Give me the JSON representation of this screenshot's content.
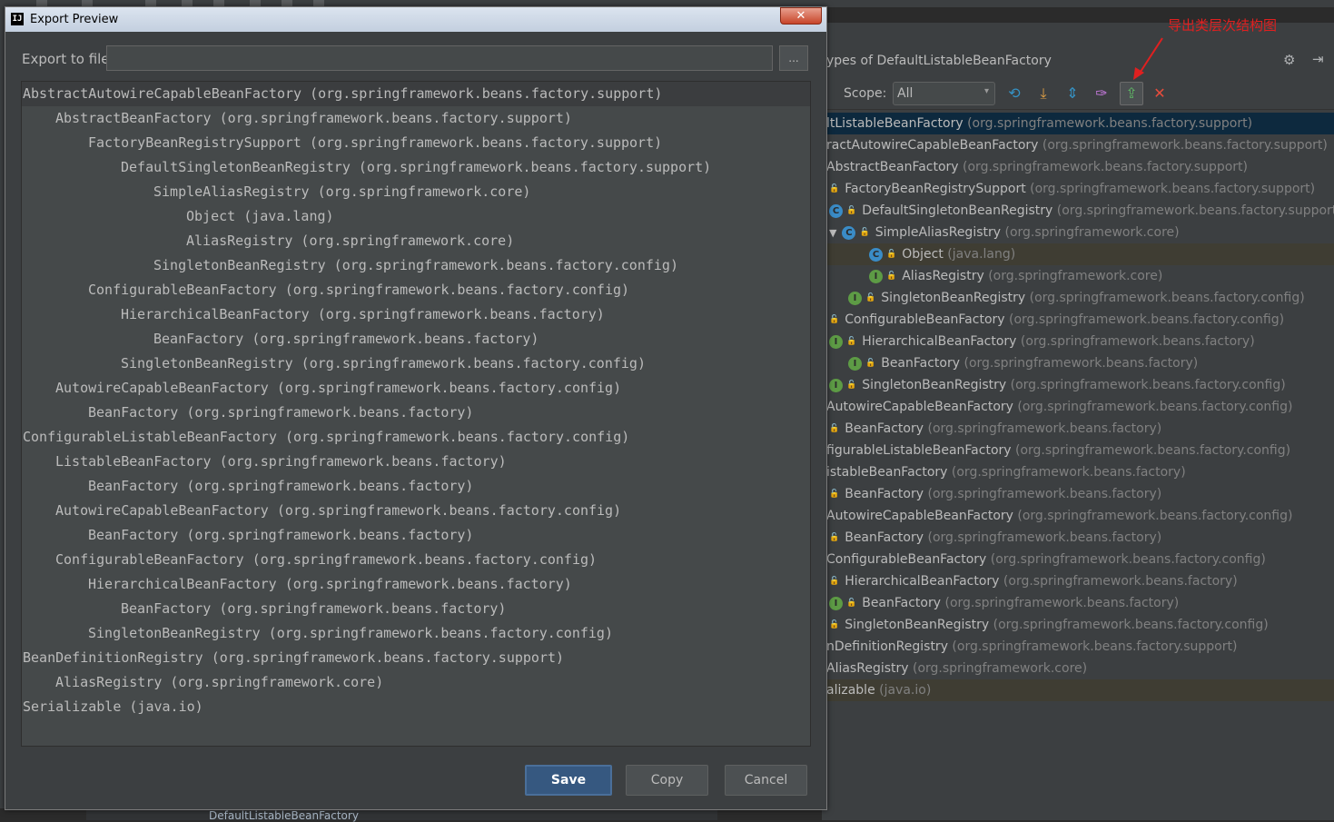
{
  "dialog": {
    "title": "Export Preview",
    "app_icon": "IJ",
    "close_glyph": "✕",
    "export_label": "Export to file:",
    "export_value": "",
    "browse_label": "...",
    "save_label": "Save",
    "copy_label": "Copy",
    "cancel_label": "Cancel",
    "lines": [
      {
        "depth": 0,
        "text": "AbstractAutowireCapableBeanFactory (org.springframework.beans.factory.support)"
      },
      {
        "depth": 1,
        "text": "AbstractBeanFactory (org.springframework.beans.factory.support)"
      },
      {
        "depth": 2,
        "text": "FactoryBeanRegistrySupport (org.springframework.beans.factory.support)"
      },
      {
        "depth": 3,
        "text": "DefaultSingletonBeanRegistry (org.springframework.beans.factory.support)"
      },
      {
        "depth": 4,
        "text": "SimpleAliasRegistry (org.springframework.core)"
      },
      {
        "depth": 5,
        "text": "Object (java.lang)"
      },
      {
        "depth": 5,
        "text": "AliasRegistry (org.springframework.core)"
      },
      {
        "depth": 4,
        "text": "SingletonBeanRegistry (org.springframework.beans.factory.config)"
      },
      {
        "depth": 2,
        "text": "ConfigurableBeanFactory (org.springframework.beans.factory.config)"
      },
      {
        "depth": 3,
        "text": "HierarchicalBeanFactory (org.springframework.beans.factory)"
      },
      {
        "depth": 4,
        "text": "BeanFactory (org.springframework.beans.factory)"
      },
      {
        "depth": 3,
        "text": "SingletonBeanRegistry (org.springframework.beans.factory.config)"
      },
      {
        "depth": 1,
        "text": "AutowireCapableBeanFactory (org.springframework.beans.factory.config)"
      },
      {
        "depth": 2,
        "text": "BeanFactory (org.springframework.beans.factory)"
      },
      {
        "depth": 0,
        "text": "ConfigurableListableBeanFactory (org.springframework.beans.factory.config)"
      },
      {
        "depth": 1,
        "text": "ListableBeanFactory (org.springframework.beans.factory)"
      },
      {
        "depth": 2,
        "text": "BeanFactory (org.springframework.beans.factory)"
      },
      {
        "depth": 1,
        "text": "AutowireCapableBeanFactory (org.springframework.beans.factory.config)"
      },
      {
        "depth": 2,
        "text": "BeanFactory (org.springframework.beans.factory)"
      },
      {
        "depth": 1,
        "text": "ConfigurableBeanFactory (org.springframework.beans.factory.config)"
      },
      {
        "depth": 2,
        "text": "HierarchicalBeanFactory (org.springframework.beans.factory)"
      },
      {
        "depth": 3,
        "text": "BeanFactory (org.springframework.beans.factory)"
      },
      {
        "depth": 2,
        "text": "SingletonBeanRegistry (org.springframework.beans.factory.config)"
      },
      {
        "depth": 0,
        "text": "BeanDefinitionRegistry (org.springframework.beans.factory.support)"
      },
      {
        "depth": 1,
        "text": "AliasRegistry (org.springframework.core)"
      },
      {
        "depth": 0,
        "text": "Serializable (java.io)"
      }
    ]
  },
  "hierarchy": {
    "title": "ypes of DefaultListableBeanFactory",
    "scope_label": "Scope:",
    "scope_value": "All",
    "annotation": "导出类层次结构图",
    "icons": {
      "refresh": "⟲",
      "expand": "⤓",
      "collapse": "⇕",
      "pin": "✑",
      "export": "⇪",
      "close": "✕",
      "gear": "⚙",
      "hide": "⇥",
      "arrow": "▾"
    },
    "rows": [
      {
        "x": 5,
        "badge": "",
        "lock": false,
        "tri": false,
        "name": "ltListableBeanFactory",
        "pkg": " (org.springframework.beans.factory.support)",
        "state": "sel"
      },
      {
        "x": 5,
        "badge": "",
        "lock": false,
        "tri": false,
        "name": "ractAutowireCapableBeanFactory",
        "pkg": " (org.springframework.beans.factory.support)",
        "state": ""
      },
      {
        "x": 5,
        "badge": "",
        "lock": false,
        "tri": false,
        "name": "AbstractBeanFactory",
        "pkg": " (org.springframework.beans.factory.support)",
        "state": ""
      },
      {
        "x": 8,
        "badge": "",
        "lock": true,
        "tri": false,
        "name": "FactoryBeanRegistrySupport",
        "pkg": " (org.springframework.beans.factory.support)",
        "state": ""
      },
      {
        "x": 8,
        "badge": "C",
        "lock": true,
        "tri": false,
        "name": "DefaultSingletonBeanRegistry",
        "pkg": " (org.springframework.beans.factory.support)",
        "state": ""
      },
      {
        "x": 8,
        "badge": "C",
        "lock": true,
        "tri": true,
        "name": "SimpleAliasRegistry",
        "pkg": " (org.springframework.core)",
        "state": ""
      },
      {
        "x": 52,
        "badge": "C",
        "lock": true,
        "tri": false,
        "name": "Object",
        "pkg": " (java.lang)",
        "state": "hl"
      },
      {
        "x": 52,
        "badge": "I",
        "lock": true,
        "tri": false,
        "name": "AliasRegistry",
        "pkg": " (org.springframework.core)",
        "state": ""
      },
      {
        "x": 29,
        "badge": "I",
        "lock": true,
        "tri": false,
        "name": "SingletonBeanRegistry",
        "pkg": " (org.springframework.beans.factory.config)",
        "state": ""
      },
      {
        "x": 8,
        "badge": "",
        "lock": true,
        "tri": false,
        "name": "ConfigurableBeanFactory",
        "pkg": " (org.springframework.beans.factory.config)",
        "state": ""
      },
      {
        "x": 8,
        "badge": "I",
        "lock": true,
        "tri": false,
        "name": "HierarchicalBeanFactory",
        "pkg": " (org.springframework.beans.factory)",
        "state": ""
      },
      {
        "x": 29,
        "badge": "I",
        "lock": true,
        "tri": false,
        "name": "BeanFactory",
        "pkg": " (org.springframework.beans.factory)",
        "state": ""
      },
      {
        "x": 8,
        "badge": "I",
        "lock": true,
        "tri": false,
        "name": "SingletonBeanRegistry",
        "pkg": " (org.springframework.beans.factory.config)",
        "state": ""
      },
      {
        "x": 5,
        "badge": "",
        "lock": false,
        "tri": false,
        "name": "AutowireCapableBeanFactory",
        "pkg": " (org.springframework.beans.factory.config)",
        "state": ""
      },
      {
        "x": 8,
        "badge": "",
        "lock": true,
        "tri": false,
        "name": "BeanFactory",
        "pkg": " (org.springframework.beans.factory)",
        "state": ""
      },
      {
        "x": 5,
        "badge": "",
        "lock": false,
        "tri": false,
        "name": "figurableListableBeanFactory",
        "pkg": " (org.springframework.beans.factory.config)",
        "state": ""
      },
      {
        "x": 5,
        "badge": "",
        "lock": false,
        "tri": false,
        "name": "istableBeanFactory",
        "pkg": " (org.springframework.beans.factory)",
        "state": ""
      },
      {
        "x": 8,
        "badge": "",
        "lock": true,
        "tri": false,
        "name": "BeanFactory",
        "pkg": " (org.springframework.beans.factory)",
        "state": ""
      },
      {
        "x": 5,
        "badge": "",
        "lock": false,
        "tri": false,
        "name": "AutowireCapableBeanFactory",
        "pkg": " (org.springframework.beans.factory.config)",
        "state": ""
      },
      {
        "x": 8,
        "badge": "",
        "lock": true,
        "tri": false,
        "name": "BeanFactory",
        "pkg": " (org.springframework.beans.factory)",
        "state": ""
      },
      {
        "x": 5,
        "badge": "",
        "lock": false,
        "tri": false,
        "name": "ConfigurableBeanFactory",
        "pkg": " (org.springframework.beans.factory.config)",
        "state": ""
      },
      {
        "x": 8,
        "badge": "",
        "lock": true,
        "tri": false,
        "name": "HierarchicalBeanFactory",
        "pkg": " (org.springframework.beans.factory)",
        "state": ""
      },
      {
        "x": 8,
        "badge": "I",
        "lock": true,
        "tri": false,
        "name": "BeanFactory",
        "pkg": " (org.springframework.beans.factory)",
        "state": ""
      },
      {
        "x": 8,
        "badge": "",
        "lock": true,
        "tri": false,
        "name": "SingletonBeanRegistry",
        "pkg": " (org.springframework.beans.factory.config)",
        "state": ""
      },
      {
        "x": 5,
        "badge": "",
        "lock": false,
        "tri": false,
        "name": "nDefinitionRegistry",
        "pkg": " (org.springframework.beans.factory.support)",
        "state": ""
      },
      {
        "x": 5,
        "badge": "",
        "lock": false,
        "tri": false,
        "name": "AliasRegistry",
        "pkg": " (org.springframework.core)",
        "state": ""
      },
      {
        "x": 5,
        "badge": "",
        "lock": false,
        "tri": false,
        "name": "alizable",
        "pkg": " (java.io)",
        "state": "hl"
      }
    ]
  },
  "background": {
    "bottom_text": "DefaultListableBeanFactory"
  }
}
